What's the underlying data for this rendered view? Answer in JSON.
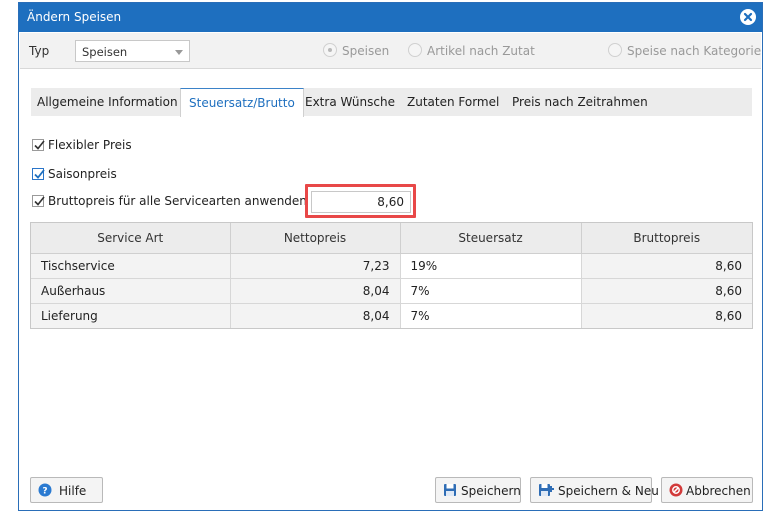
{
  "window": {
    "title": "Ändern Speisen"
  },
  "typ": {
    "label": "Typ",
    "selected": "Speisen",
    "radios": [
      {
        "label": "Speisen",
        "checked": true
      },
      {
        "label": "Artikel nach Zutat",
        "checked": false
      },
      {
        "label": "Speise nach Kategorie",
        "checked": false
      }
    ]
  },
  "tabs": [
    {
      "label": "Allgemeine Information"
    },
    {
      "label": "Steuersatz/Brutto",
      "active": true
    },
    {
      "label": "Extra Wünsche"
    },
    {
      "label": "Zutaten Formel"
    },
    {
      "label": "Preis nach Zeitrahmen"
    }
  ],
  "options": {
    "flexibler_preis": "Flexibler Preis",
    "saisonpreis": "Saisonpreis",
    "brutto_all": "Bruttopreis für alle Servicearten anwenden",
    "brutto_value": "8,60"
  },
  "table": {
    "headers": [
      "Service Art",
      "Nettopreis",
      "Steuersatz",
      "Bruttopreis"
    ],
    "rows": [
      [
        "Tischservice",
        "7,23",
        "19%",
        "8,60"
      ],
      [
        "Außerhaus",
        "8,04",
        "7%",
        "8,60"
      ],
      [
        "Lieferung",
        "8,04",
        "7%",
        "8,60"
      ]
    ]
  },
  "buttons": {
    "help": "Hilfe",
    "save": "Speichern",
    "save_new": "Speichern & Neu",
    "cancel": "Abbrechen"
  },
  "colors": {
    "accent": "#1e6fbf",
    "highlight": "#e84848"
  }
}
